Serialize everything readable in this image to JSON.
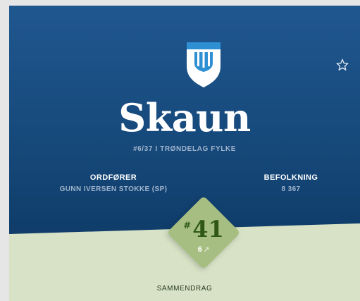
{
  "municipality": {
    "name": "Skaun",
    "rank_line": "#6/37 I TRØNDELAG FYLKE"
  },
  "mayor": {
    "label": "ORDFØRER",
    "value": "GUNN IVERSEN STOKKE (SP)"
  },
  "population": {
    "label": "BEFOLKNING",
    "value": "8 367"
  },
  "score": {
    "hash": "#",
    "rank": "41",
    "change": "6",
    "change_icon": "arrow-up-right-icon"
  },
  "summary_label": "SAMMENDRAG",
  "icons": {
    "crest": "coat-of-arms-icon",
    "favorite": "star-outline-icon"
  },
  "colors": {
    "hero_top": "#1f578f",
    "hero_bottom": "#0f3c69",
    "accent_green": "#a6be82",
    "score_text": "#2f5716",
    "background_green": "#d7e2c6",
    "crest_blue": "#2f8fd3"
  }
}
